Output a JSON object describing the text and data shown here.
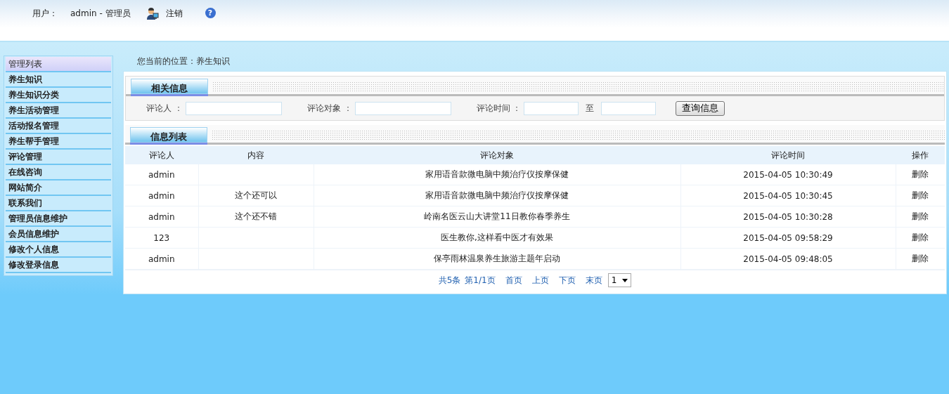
{
  "header": {
    "user_label": "用户：",
    "user_name": "admin - 管理员",
    "logout": "注销",
    "help": "?"
  },
  "sidebar": {
    "title": "管理列表",
    "items": [
      "养生知识",
      "养生知识分类",
      "养生活动管理",
      "活动报名管理",
      "养生帮手管理",
      "评论管理",
      "在线咨询",
      "网站简介",
      "联系我们",
      "管理员信息维护",
      "会员信息维护",
      "修改个人信息",
      "修改登录信息"
    ]
  },
  "breadcrumb": "您当前的位置：养生知识",
  "search": {
    "title": "相关信息",
    "fields": [
      {
        "label": "评论人 ："
      },
      {
        "label": "评论对象 ："
      },
      {
        "label": "评论时间 ："
      }
    ],
    "range_sep": "至",
    "button": "查询信息"
  },
  "table": {
    "title": "信息列表",
    "columns": [
      "评论人",
      "内容",
      "评论对象",
      "评论时间",
      "操作"
    ],
    "rows": [
      {
        "user": "admin",
        "target": "家用语音款微电脑中频治疗仪按摩保健",
        "time": "2015-04-05 10:30:49",
        "action": "删除"
      },
      {
        "user": "admin",
        "content": "这个还可以",
        "target": "家用语音款微电脑中频治疗仪按摩保健",
        "time": "2015-04-05 10:30:45",
        "action": "删除"
      },
      {
        "user": "admin",
        "content": "这个还不错",
        "target": "岭南名医云山大讲堂11日教你春季养生",
        "time": "2015-04-05 10:30:28",
        "action": "删除"
      },
      {
        "user": "123",
        "target": "医生教你,这样看中医才有效果",
        "time": "2015-04-05 09:58:29",
        "action": "删除"
      },
      {
        "user": "admin",
        "target": "保亭雨林温泉养生旅游主题年启动",
        "time": "2015-04-05 09:48:05",
        "action": "删除"
      }
    ]
  },
  "pager": {
    "summary": "共5条",
    "page": "第1/1页",
    "links": [
      "首页",
      "上页",
      "下页",
      "末页"
    ],
    "select": "1"
  }
}
